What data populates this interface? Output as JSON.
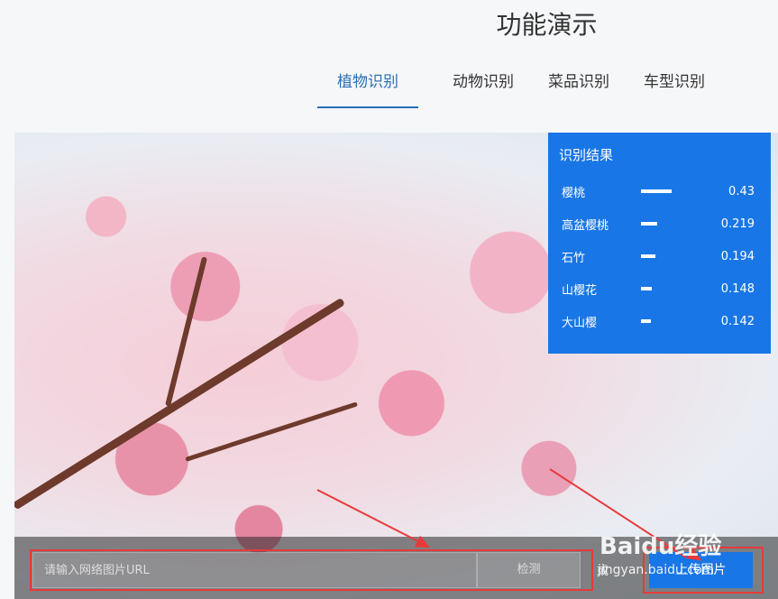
{
  "page": {
    "title": "功能演示"
  },
  "tabs": [
    {
      "label": "植物识别",
      "active": true
    },
    {
      "label": "动物识别",
      "active": false
    },
    {
      "label": "菜品识别",
      "active": false
    },
    {
      "label": "车型识别",
      "active": false
    }
  ],
  "result": {
    "title": "识别结果",
    "items": [
      {
        "name": "樱桃",
        "score": "0.43",
        "fraction": 0.43
      },
      {
        "name": "高盆樱桃",
        "score": "0.219",
        "fraction": 0.219
      },
      {
        "name": "石竹",
        "score": "0.194",
        "fraction": 0.194
      },
      {
        "name": "山樱花",
        "score": "0.148",
        "fraction": 0.148
      },
      {
        "name": "大山樱",
        "score": "0.142",
        "fraction": 0.142
      }
    ]
  },
  "input": {
    "placeholder": "请输入网络图片URL",
    "value": ""
  },
  "buttons": {
    "detect": "检测",
    "or": "或",
    "upload": "上传图片"
  },
  "watermark": {
    "brand": "Baidu经验",
    "url": "jingyan.baidu.com"
  },
  "colors": {
    "accent": "#1976e6",
    "tab_active": "#2b6fb5",
    "annotation": "#e83a3a"
  }
}
